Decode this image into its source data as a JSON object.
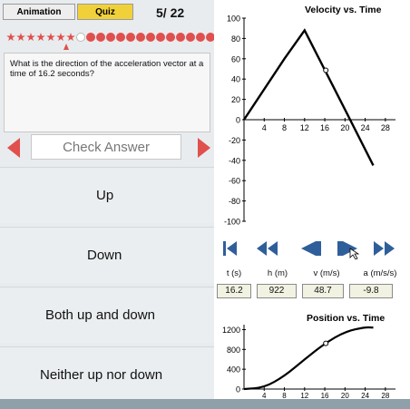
{
  "tabs": {
    "animation_label": "Animation",
    "quiz_label": "Quiz"
  },
  "quiz": {
    "score": "5/ 22",
    "progress": {
      "completed": 7,
      "total": 22,
      "current_index": 7
    },
    "question": "What is the direction of the acceleration vector at a time of 16.2 seconds?",
    "check_label": "Check Answer",
    "answers": [
      "Up",
      "Down",
      "Both up and down",
      "Neither up nor down"
    ]
  },
  "velocity_chart": {
    "title": "Velocity vs. Time",
    "y_ticks": [
      "100",
      "80",
      "60",
      "40",
      "20",
      "0",
      "-20",
      "-40",
      "-60",
      "-80",
      "-100"
    ],
    "x_ticks": [
      "4",
      "8",
      "12",
      "16",
      "20",
      "24",
      "28"
    ]
  },
  "playback": {
    "buttons": [
      "skip-back",
      "rewind",
      "step-back",
      "play",
      "fast-forward"
    ]
  },
  "readout": {
    "headers": [
      "t (s)",
      "h (m)",
      "v (m/s)",
      "a (m/s/s)"
    ],
    "values": [
      "16.2",
      "922",
      "48.7",
      "-9.8"
    ]
  },
  "position_chart": {
    "title": "Position vs. Time",
    "y_ticks": [
      "1200",
      "800",
      "400",
      "0"
    ],
    "x_ticks": [
      "4",
      "8",
      "12",
      "16",
      "20",
      "24",
      "28"
    ]
  },
  "chart_data": [
    {
      "type": "line",
      "title": "Velocity vs. Time",
      "xlabel": "",
      "ylabel": "",
      "xlim": [
        0,
        30
      ],
      "ylim": [
        -100,
        100
      ],
      "x": [
        0,
        8,
        12,
        20,
        25.6
      ],
      "series": [
        {
          "values": [
            0,
            60,
            88,
            10,
            -45
          ]
        }
      ],
      "marker": {
        "x": 16.2,
        "y": 48.7
      }
    },
    {
      "type": "line",
      "title": "Position vs. Time",
      "xlabel": "",
      "ylabel": "",
      "xlim": [
        0,
        30
      ],
      "ylim": [
        0,
        1300
      ],
      "x": [
        0,
        4,
        8,
        12,
        16,
        20,
        24,
        25.6
      ],
      "series": [
        {
          "values": [
            0,
            30,
            260,
            600,
            920,
            1160,
            1250,
            1240
          ]
        }
      ],
      "marker": {
        "x": 16.2,
        "y": 922
      }
    }
  ],
  "colors": {
    "accent_red": "#e0504e",
    "quiz_tab": "#f1d13a",
    "control_blue": "#2f5f9a"
  }
}
